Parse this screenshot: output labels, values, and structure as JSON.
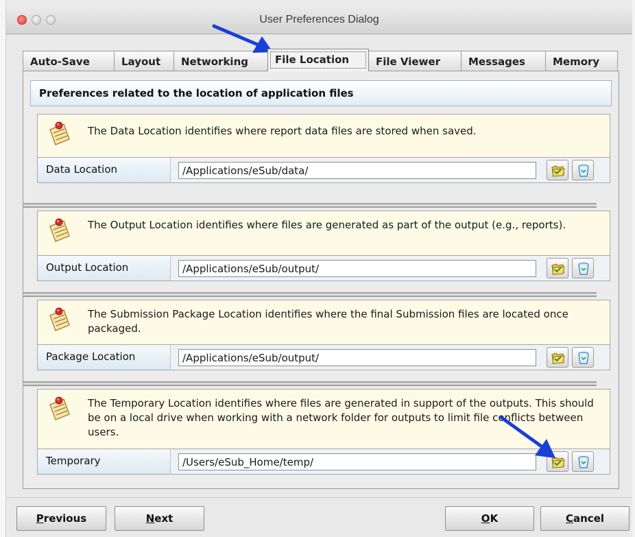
{
  "window": {
    "title": "User Preferences Dialog"
  },
  "tabs": [
    {
      "label": "Auto-Save"
    },
    {
      "label": "Layout"
    },
    {
      "label": "Networking"
    },
    {
      "label": "File Location"
    },
    {
      "label": "File Viewer"
    },
    {
      "label": "Messages"
    },
    {
      "label": "Memory"
    }
  ],
  "active_tab": "File Location",
  "panel": {
    "header": "Preferences related to the location of application files",
    "sections": [
      {
        "info": "The Data Location identifies where report data files are stored when saved.",
        "label": "Data Location",
        "value": "/Applications/eSub/data/"
      },
      {
        "info": "The Output Location identifies where files are generated as part of the output (e.g., reports).",
        "label": "Output Location",
        "value": "/Applications/eSub/output/"
      },
      {
        "info": "The Submission Package Location identifies where the final Submission files are located once packaged.",
        "label": "Package Location",
        "value": "/Applications/eSub/output/"
      },
      {
        "info": "The Temporary Location identifies where files are generated in support of the outputs. This should be on a local drive when working with a network folder for outputs to limit file conflicts between users.",
        "label": "Temporary",
        "value": "/Users/eSub_Home/temp/"
      }
    ]
  },
  "buttons": {
    "previous": {
      "mnemonic": "P",
      "rest": "revious"
    },
    "next": {
      "mnemonic": "N",
      "rest": "ext"
    },
    "ok": {
      "mnemonic": "O",
      "rest": "K"
    },
    "cancel": {
      "mnemonic": "C",
      "rest": "ancel"
    }
  },
  "icons": {
    "note": "sticky-note-pin-icon",
    "browse": "open-folder-icon",
    "clear": "trash-can-icon",
    "annotation": "blue-arrow-icon"
  },
  "colors": {
    "header_bg": "#e2edf5",
    "info_bg": "#fdfbe6",
    "arrow": "#1a3fd6"
  }
}
